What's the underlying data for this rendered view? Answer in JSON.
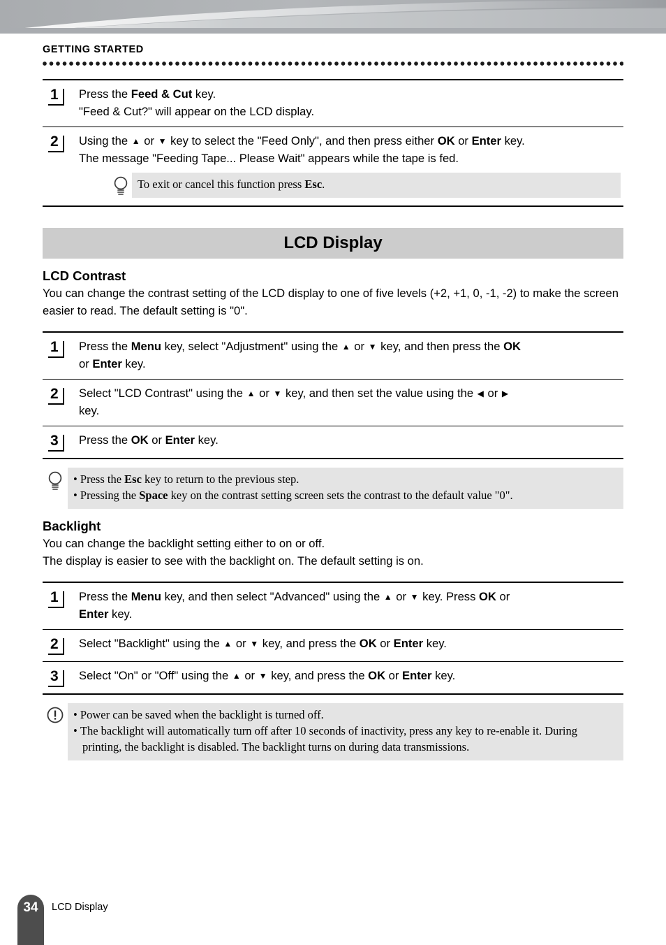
{
  "running_head": "GETTING STARTED",
  "feed_steps": [
    {
      "num": "1",
      "lines": [
        [
          {
            "t": "Press the "
          },
          {
            "t": "Feed & Cut",
            "b": true
          },
          {
            "t": " key."
          }
        ],
        [
          {
            "t": "\"Feed & Cut?\" will appear on the LCD display."
          }
        ]
      ]
    },
    {
      "num": "2",
      "lines": [
        [
          {
            "t": "Using the "
          },
          {
            "t": "▲",
            "k": true
          },
          {
            "t": " or "
          },
          {
            "t": "▼",
            "k": true
          },
          {
            "t": " key to select the \"Feed Only\", and then press either "
          },
          {
            "t": "OK",
            "b": true
          },
          {
            "t": " or "
          },
          {
            "t": "Enter",
            "b": true
          },
          {
            "t": " key."
          }
        ],
        [
          {
            "t": "The message \"Feeding Tape... Please Wait\" appears while the tape is fed."
          }
        ]
      ],
      "tip": {
        "icon": "lightbulb-icon",
        "lines": [
          [
            {
              "t": "To exit or cancel this function press "
            },
            {
              "t": "Esc",
              "b": true
            },
            {
              "t": "."
            }
          ]
        ]
      }
    }
  ],
  "section": {
    "title": "LCD Display"
  },
  "contrast": {
    "heading": "LCD Contrast",
    "intro": "You can change the contrast setting of the LCD display to one of five levels (+2, +1, 0, -1, -2) to make the screen easier to read. The default setting is \"0\".",
    "steps": [
      {
        "num": "1",
        "lines": [
          [
            {
              "t": "Press the "
            },
            {
              "t": "Menu",
              "b": true
            },
            {
              "t": " key, select \"Adjustment\" using the "
            },
            {
              "t": "▲",
              "k": true
            },
            {
              "t": " or "
            },
            {
              "t": "▼",
              "k": true
            },
            {
              "t": " key, and then press the "
            },
            {
              "t": "OK",
              "b": true
            }
          ],
          [
            {
              "t": "or "
            },
            {
              "t": "Enter",
              "b": true
            },
            {
              "t": " key."
            }
          ]
        ]
      },
      {
        "num": "2",
        "lines": [
          [
            {
              "t": "Select \"LCD Contrast\" using the "
            },
            {
              "t": "▲",
              "k": true
            },
            {
              "t": " or "
            },
            {
              "t": "▼",
              "k": true
            },
            {
              "t": " key, and then set the value using the "
            },
            {
              "t": "◀",
              "k": true
            },
            {
              "t": " or "
            },
            {
              "t": "▶",
              "k": true
            }
          ],
          [
            {
              "t": "key."
            }
          ]
        ]
      },
      {
        "num": "3",
        "lines": [
          [
            {
              "t": "Press the "
            },
            {
              "t": "OK",
              "b": true
            },
            {
              "t": " or "
            },
            {
              "t": "Enter",
              "b": true
            },
            {
              "t": " key."
            }
          ]
        ]
      }
    ],
    "note": {
      "icon": "lightbulb-icon",
      "bullets": [
        [
          {
            "t": "Press the "
          },
          {
            "t": "Esc",
            "b": true
          },
          {
            "t": " key to return to the previous step."
          }
        ],
        [
          {
            "t": "Pressing the "
          },
          {
            "t": "Space",
            "b": true
          },
          {
            "t": " key on the contrast setting screen sets the contrast to the default value \"0\"."
          }
        ]
      ]
    }
  },
  "backlight": {
    "heading": "Backlight",
    "intro_lines": [
      "You can change the backlight setting either to on or off.",
      "The display is easier to see with the backlight on. The default setting is on."
    ],
    "steps": [
      {
        "num": "1",
        "lines": [
          [
            {
              "t": "Press the "
            },
            {
              "t": "Menu",
              "b": true
            },
            {
              "t": " key, and then select \"Advanced\" using the "
            },
            {
              "t": "▲",
              "k": true
            },
            {
              "t": " or "
            },
            {
              "t": "▼",
              "k": true
            },
            {
              "t": " key. Press "
            },
            {
              "t": "OK",
              "b": true
            },
            {
              "t": " or"
            }
          ],
          [
            {
              "t": "Enter",
              "b": true
            },
            {
              "t": " key."
            }
          ]
        ]
      },
      {
        "num": "2",
        "lines": [
          [
            {
              "t": "Select \"Backlight\" using the "
            },
            {
              "t": "▲",
              "k": true
            },
            {
              "t": " or "
            },
            {
              "t": "▼",
              "k": true
            },
            {
              "t": " key, and press the "
            },
            {
              "t": "OK",
              "b": true
            },
            {
              "t": " or "
            },
            {
              "t": "Enter",
              "b": true
            },
            {
              "t": " key."
            }
          ]
        ]
      },
      {
        "num": "3",
        "lines": [
          [
            {
              "t": "Select \"On\" or \"Off\" using the "
            },
            {
              "t": "▲",
              "k": true
            },
            {
              "t": " or "
            },
            {
              "t": "▼",
              "k": true
            },
            {
              "t": " key, and press the "
            },
            {
              "t": "OK",
              "b": true
            },
            {
              "t": " or "
            },
            {
              "t": "Enter",
              "b": true
            },
            {
              "t": " key."
            }
          ]
        ]
      }
    ],
    "note": {
      "icon": "exclamation-circle-icon",
      "bullets": [
        [
          {
            "t": "Power can be saved when the backlight is turned off."
          }
        ],
        [
          {
            "t": "The backlight will automatically turn off after 10 seconds of inactivity, press any key to re-enable it. During printing, the backlight is disabled. The backlight turns on during data transmissions."
          }
        ]
      ]
    }
  },
  "footer": {
    "page_number": "34",
    "label": "LCD Display"
  },
  "colors": {
    "section_bar": "#cccccc",
    "callout_bg": "#e4e4e4",
    "page_tab": "#4d4d4d",
    "banner_gray": "#a7aaad"
  }
}
